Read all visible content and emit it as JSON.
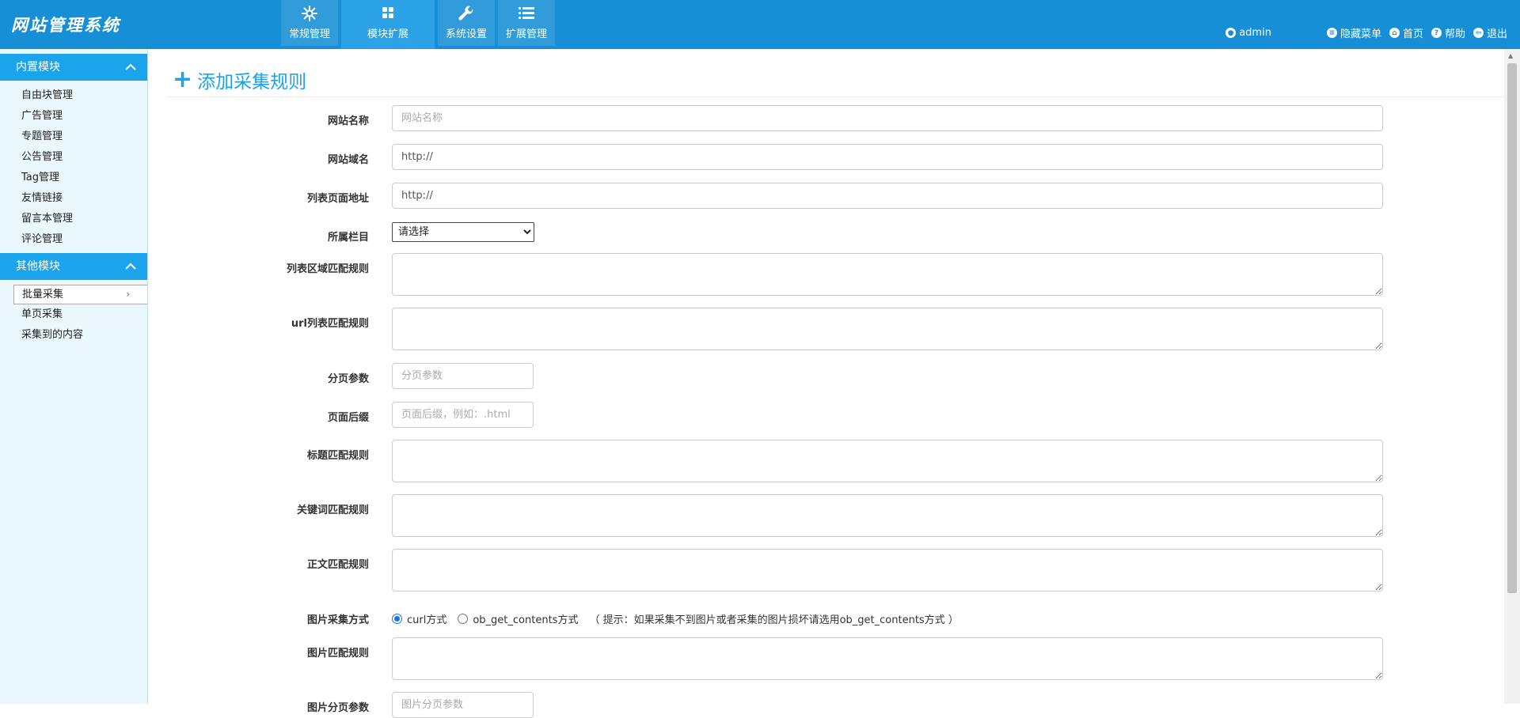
{
  "app": {
    "logo": "网站管理系统"
  },
  "topnav": [
    {
      "label": "常规管理",
      "icon": "snowflake-icon"
    },
    {
      "label": "模块扩展",
      "icon": "grid-icon"
    },
    {
      "label": "系统设置",
      "icon": "wrench-icon"
    },
    {
      "label": "扩展管理",
      "icon": "list-icon"
    }
  ],
  "topright": {
    "user": "admin",
    "hide_menu": "隐藏菜单",
    "home": "首页",
    "help": "帮助",
    "logout": "退出"
  },
  "sidebar": {
    "section1": {
      "title": "内置模块",
      "items": [
        "自由块管理",
        "广告管理",
        "专题管理",
        "公告管理",
        "Tag管理",
        "友情链接",
        "留言本管理",
        "评论管理"
      ]
    },
    "section2": {
      "title": "其他模块",
      "items": [
        "批量采集",
        "单页采集",
        "采集到的内容"
      ]
    }
  },
  "page": {
    "title": "添加采集规则"
  },
  "form": {
    "site_name": {
      "label": "网站名称",
      "placeholder": "网站名称"
    },
    "site_domain": {
      "label": "网站域名",
      "value": "http://"
    },
    "list_url": {
      "label": "列表页面地址",
      "value": "http://"
    },
    "category": {
      "label": "所属栏目",
      "selected": "请选择"
    },
    "list_area_rule": {
      "label": "列表区域匹配规则"
    },
    "url_list_rule": {
      "label": "url列表匹配规则"
    },
    "page_param": {
      "label": "分页参数",
      "placeholder": "分页参数"
    },
    "page_suffix": {
      "label": "页面后缀",
      "placeholder": "页面后缀，例如：.html"
    },
    "title_rule": {
      "label": "标题匹配规则"
    },
    "keyword_rule": {
      "label": "关键词匹配规则"
    },
    "body_rule": {
      "label": "正文匹配规则"
    },
    "image_method": {
      "label": "图片采集方式",
      "option1": "curl方式",
      "option2": "ob_get_contents方式",
      "hint": "（ 提示：如果采集不到图片或者采集的图片损坏请选用ob_get_contents方式 ）"
    },
    "image_rule": {
      "label": "图片匹配规则"
    },
    "image_page_param": {
      "label": "图片分页参数",
      "placeholder": "图片分页参数"
    }
  }
}
